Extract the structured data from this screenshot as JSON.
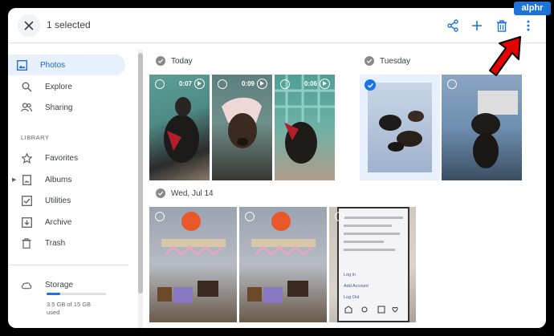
{
  "header": {
    "selected_count_text": "1 selected",
    "icons": [
      "close-icon",
      "share-icon",
      "add-icon",
      "trash-icon",
      "more-vert-icon"
    ]
  },
  "watermark": {
    "text": "alphr"
  },
  "sidebar": {
    "items": [
      {
        "label": "Photos",
        "icon": "photos-icon",
        "active": true
      },
      {
        "label": "Explore",
        "icon": "search-icon"
      },
      {
        "label": "Sharing",
        "icon": "people-icon"
      }
    ],
    "library_label": "LIBRARY",
    "library_items": [
      {
        "label": "Favorites",
        "icon": "star-icon"
      },
      {
        "label": "Albums",
        "icon": "album-icon"
      },
      {
        "label": "Utilities",
        "icon": "utilities-icon"
      },
      {
        "label": "Archive",
        "icon": "archive-icon"
      },
      {
        "label": "Trash",
        "icon": "trash-icon"
      }
    ],
    "storage": {
      "label": "Storage",
      "used_line1": "3.5 GB of 15 GB",
      "used_line2": "used",
      "used_fraction": 0.23
    }
  },
  "groups": [
    {
      "title": "Today",
      "videos": [
        {
          "duration": "0:07"
        },
        {
          "duration": "0:09"
        },
        {
          "duration": "0:06"
        }
      ]
    },
    {
      "title": "Tuesday",
      "photos": [
        {
          "selected": true
        },
        {
          "selected": false
        }
      ]
    },
    {
      "title": "Wed, Jul 14"
    }
  ],
  "screenshot_photo": {
    "links": [
      "Log in",
      "Add Account",
      "Log Out"
    ]
  },
  "colors": {
    "accent": "#1a73e8",
    "active_nav_bg": "#e8f0fe",
    "arrow": "#e60000",
    "watermark_bg": "#1e73d9"
  }
}
